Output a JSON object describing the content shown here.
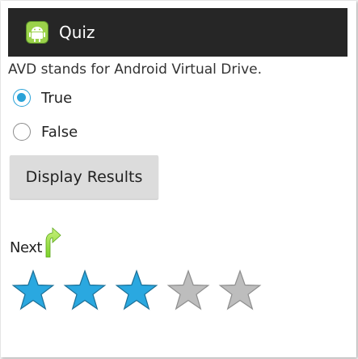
{
  "app": {
    "title": "Quiz",
    "icon": "android-robot-icon"
  },
  "question": {
    "text": "AVD stands for Android Virtual Drive."
  },
  "options": [
    {
      "label": "True",
      "checked": true
    },
    {
      "label": "False",
      "checked": false
    }
  ],
  "button": {
    "label": "Display Results"
  },
  "next": {
    "label": "Next",
    "icon": "green-arrow-icon"
  },
  "rating": {
    "value": 3,
    "max": 5
  },
  "colors": {
    "actionbar": "#262626",
    "accent": "#2aa2d8",
    "star_filled": "#2aa8e0",
    "star_empty": "#bdbdbd",
    "button_bg": "#dcdcdc"
  }
}
